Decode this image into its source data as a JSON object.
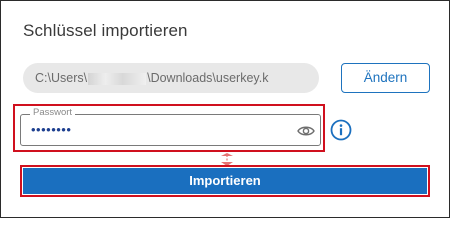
{
  "dialog": {
    "title": "Schlüssel importieren",
    "file_path_prefix": "C:\\Users\\",
    "file_path_suffix": "\\Downloads\\userkey.k",
    "change_button": "Ändern",
    "password": {
      "label": "Passwort",
      "masked_value": "••••••••"
    },
    "import_button": "Importieren"
  },
  "colors": {
    "accent": "#1a6fbf",
    "highlight": "#d0101e",
    "field_bg": "#e8e8e8"
  },
  "icons": [
    "eye-icon",
    "info-icon",
    "arrow-connector"
  ]
}
